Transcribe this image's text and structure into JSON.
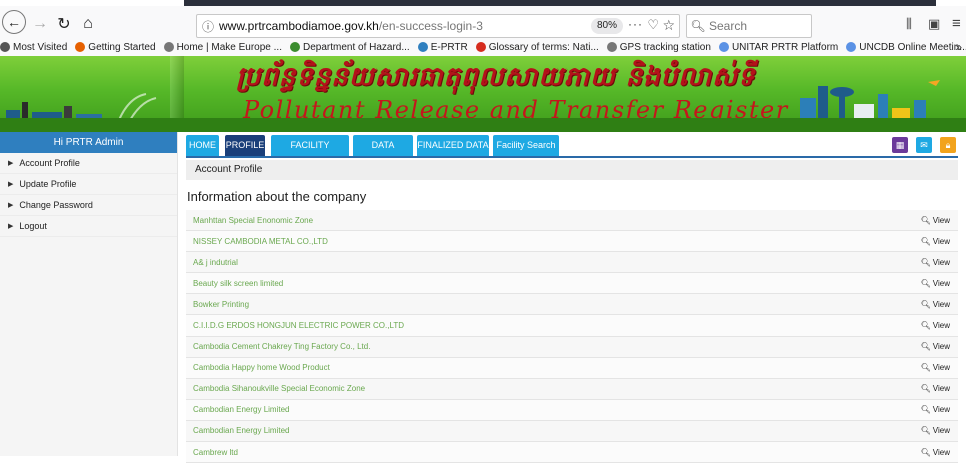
{
  "browser": {
    "url_domain": "www.prtrcambodiamoe.gov.kh",
    "url_path": "/en-success-login-3",
    "zoom": "80%",
    "search_placeholder": "Search",
    "more_glyph": "···"
  },
  "bookmarks": [
    {
      "label": "Most Visited",
      "icon": "gear-icon",
      "color": "#555555"
    },
    {
      "label": "Getting Started",
      "icon": "firefox-icon",
      "color": "#e66000"
    },
    {
      "label": "Home | Make Europe ...",
      "icon": "globe-icon",
      "color": "#777777"
    },
    {
      "label": "Department of Hazard...",
      "icon": "globe-icon",
      "color": "#3c8d2f"
    },
    {
      "label": "E-PRTR",
      "icon": "gear-icon",
      "color": "#2f7fbf"
    },
    {
      "label": "Glossary of terms: Nati...",
      "icon": "maple-leaf-icon",
      "color": "#d52b1e"
    },
    {
      "label": "GPS tracking station",
      "icon": "globe-icon",
      "color": "#777777"
    },
    {
      "label": "UNITAR PRTR Platform",
      "icon": "un-icon",
      "color": "#5b92e5"
    },
    {
      "label": "UNCDB Online Meetin...",
      "icon": "un-icon",
      "color": "#5b92e5"
    }
  ],
  "banner": {
    "khmer_title": "ប្រព័ន្ធទិន្នន័យសារធាតុពុលសាយភាយ និងបំលាស់ទី",
    "english_title": "Pollutant Release and Transfer Register (PRTR)"
  },
  "sidebar": {
    "header": "Hi PRTR Admin",
    "items": [
      {
        "label": "Account Profile"
      },
      {
        "label": "Update Profile"
      },
      {
        "label": "Change Password"
      },
      {
        "label": "Logout"
      }
    ]
  },
  "tabs": [
    {
      "label": "HOME"
    },
    {
      "label": "PROFILE"
    },
    {
      "label": "FACILITY REPORTS"
    },
    {
      "label": "DATA ERRORS"
    },
    {
      "label": "FINALIZED DATA"
    },
    {
      "label": "Facility Search"
    }
  ],
  "breadcrumb": "Account Profile",
  "section_title": "Information about the company",
  "view_label": "View",
  "companies": [
    "Manhttan Special Enonomic Zone",
    "NISSEY CAMBODIA METAL CO.,LTD",
    "A& j indutrial",
    "Beauty silk screen limited",
    "Bowker Printing",
    "C.I.I.D.G ERDOS HONGJUN ELECTRIC POWER CO.,LTD",
    "Cambodia Cement Chakrey Ting Factory Co., Ltd.",
    "Cambodia Happy home Wood Product",
    "Cambodia Sihanoukville Special Economic Zone",
    "Cambodian Energy Limited",
    "Cambodian Energy Limited",
    "Cambrew ltd"
  ]
}
